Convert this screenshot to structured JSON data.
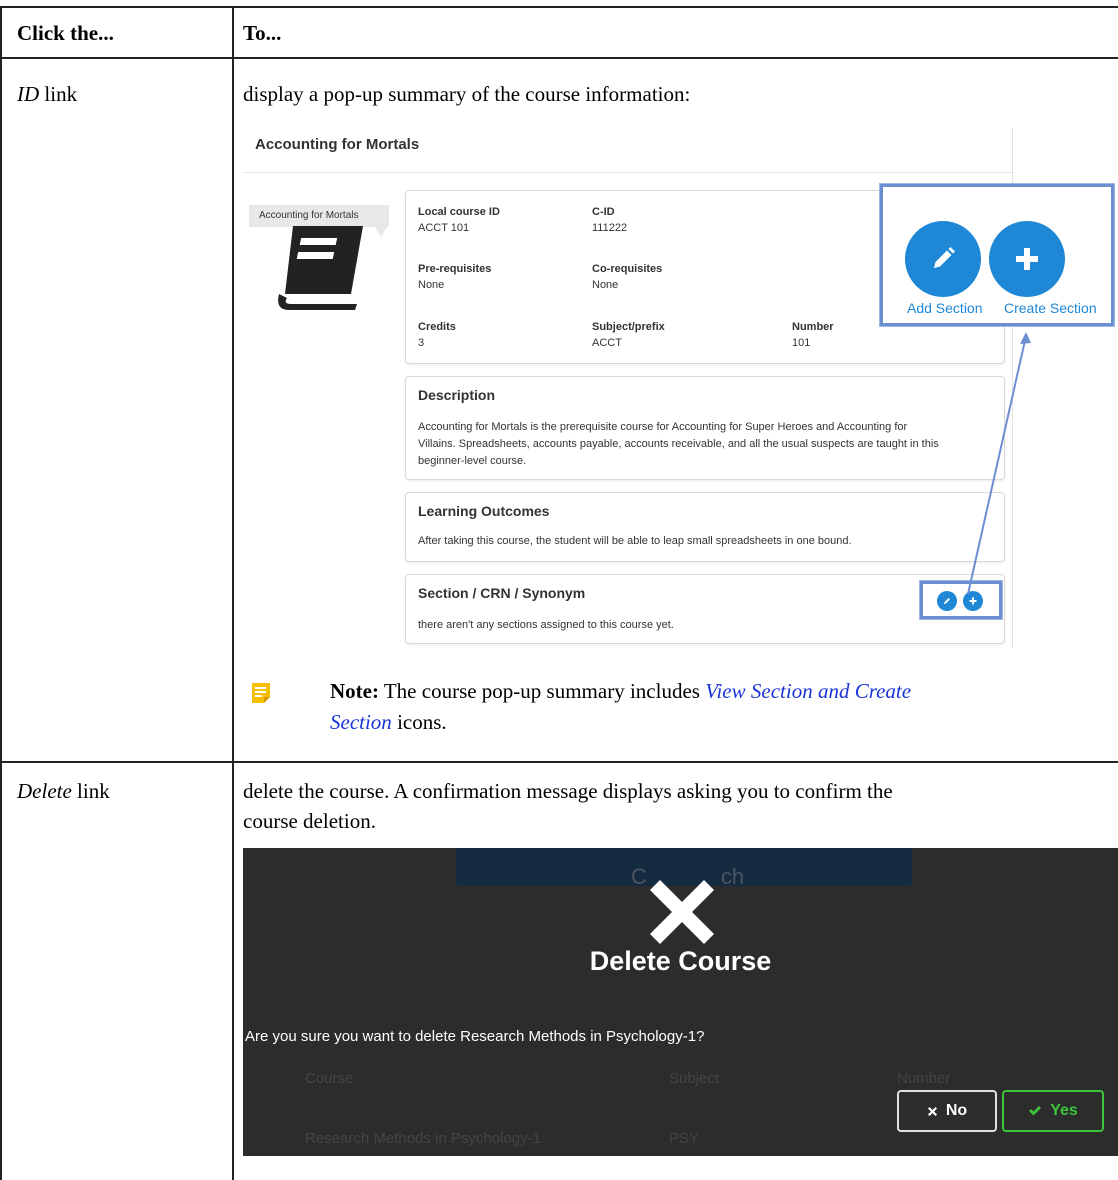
{
  "table": {
    "headers": [
      "Click the...",
      "To..."
    ],
    "row1": {
      "link": "ID",
      "link_suffix": "link",
      "description": "display a pop-up summary of the course information:"
    },
    "row2": {
      "link": "Delete",
      "link_suffix": "link",
      "description_line1": "delete the course. A confirmation message displays asking you to confirm the",
      "description_line2": "course deletion."
    }
  },
  "popup": {
    "title": "Accounting for Mortals",
    "cover_label": "Accounting for Mortals",
    "fields": {
      "local_course_id_label": "Local course ID",
      "local_course_id": "ACCT 101",
      "cid_label": "C-ID",
      "cid": "111222",
      "prereq_label": "Pre-requisites",
      "prereq": "None",
      "coreq_label": "Co-requisites",
      "coreq": "None",
      "credits_label": "Credits",
      "credits": "3",
      "subject_label": "Subject/prefix",
      "subject": "ACCT",
      "number_label": "Number",
      "number": "101"
    },
    "description": {
      "title": "Description",
      "line1": "Accounting for Mortals is the prerequisite course for Accounting for Super Heroes and Accounting for",
      "line2": "Villains. Spreadsheets, accounts payable, accounts receivable, and all the usual suspects are taught in this",
      "line3": "beginner-level course."
    },
    "outcomes": {
      "title": "Learning Outcomes",
      "text": "After taking this course, the student will be able to leap small spreadsheets in one bound."
    },
    "sections": {
      "title": "Section / CRN / Synonym",
      "text": "there aren't any sections assigned to this course yet."
    },
    "zoom": {
      "add_label": "Add Section",
      "create_label": "Create Section"
    }
  },
  "note": {
    "label": "Note:",
    "text_before": " The course pop-up summary includes ",
    "link_line1": "View Section and Create",
    "link_line2": "Section",
    "text_after": " icons."
  },
  "dialog": {
    "bg_button_text": "C",
    "bg_button_text2": "ch",
    "title": "Delete Course",
    "question": "Are you sure you want to delete Research Methods in Psychology-1?",
    "columns": [
      "Course",
      "Subject",
      "Number"
    ],
    "row": [
      "Research Methods in Psychology-1",
      "PSY"
    ],
    "no_label": "No",
    "yes_label": "Yes"
  },
  "colors": {
    "accent_blue": "#1e88d6",
    "highlight": "#6b8fd1",
    "dialog_bg": "#2c2c2c",
    "yes_green": "#3cc43c",
    "link": "#1a35d8"
  }
}
